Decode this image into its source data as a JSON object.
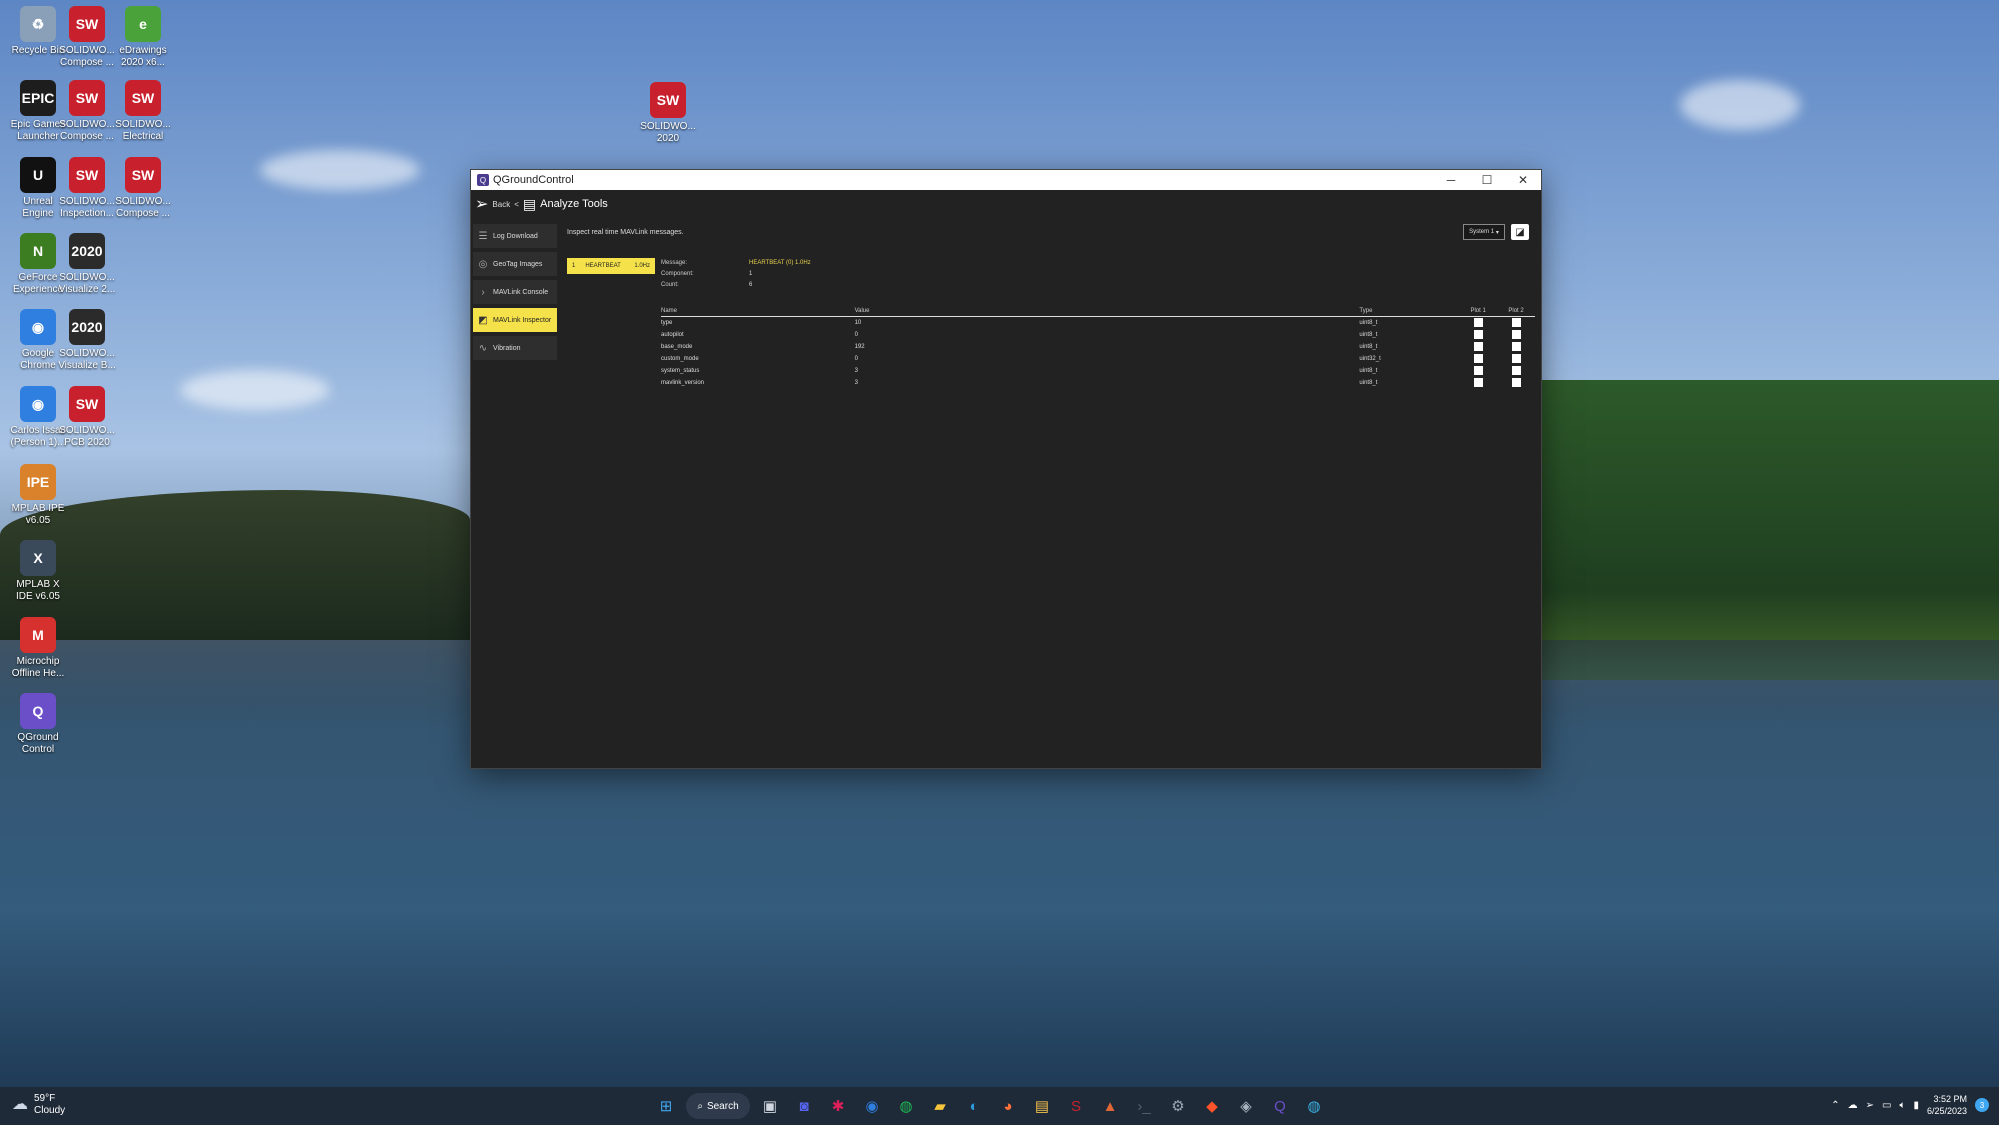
{
  "desktop": {
    "icons": [
      {
        "label": "Recycle Bin",
        "glyph": "♻",
        "color": "#8aa0b8"
      },
      {
        "label": "SOLIDWO... Compose ...",
        "glyph": "SW",
        "color": "#c8202d"
      },
      {
        "label": "eDrawings 2020 x6...",
        "glyph": "e",
        "color": "#4aa23a"
      },
      {
        "label": "Epic Games Launcher",
        "glyph": "EPIC",
        "color": "#1d1d1d"
      },
      {
        "label": "SOLIDWO... Compose ...",
        "glyph": "SW",
        "color": "#c8202d"
      },
      {
        "label": "SOLIDWO... Electrical",
        "glyph": "SW",
        "color": "#c8202d"
      },
      {
        "label": "Unreal Engine",
        "glyph": "U",
        "color": "#111111"
      },
      {
        "label": "SOLIDWO... Inspection...",
        "glyph": "SW",
        "color": "#c8202d"
      },
      {
        "label": "SOLIDWO... Compose ...",
        "glyph": "SW",
        "color": "#c8202d"
      },
      {
        "label": "GeForce Experience",
        "glyph": "N",
        "color": "#3d7d22"
      },
      {
        "label": "SOLIDWO... Visualize 2...",
        "glyph": "2020",
        "color": "#2b2b2b"
      },
      {
        "label": "Google Chrome",
        "glyph": "◉",
        "color": "#2f7fe0"
      },
      {
        "label": "SOLIDWO... Visualize B...",
        "glyph": "2020",
        "color": "#2b2b2b"
      },
      {
        "label": "Carlos Issac (Person 1)...",
        "glyph": "◉",
        "color": "#2f7fe0"
      },
      {
        "label": "SOLIDWO... PCB 2020",
        "glyph": "SW",
        "color": "#c8202d"
      },
      {
        "label": "MPLAB IPE v6.05",
        "glyph": "IPE",
        "color": "#d9822b"
      },
      {
        "label": "MPLAB X IDE v6.05",
        "glyph": "X",
        "color": "#3a4a5a"
      },
      {
        "label": "Microchip Offline He...",
        "glyph": "M",
        "color": "#d6312f"
      },
      {
        "label": "QGround Control",
        "glyph": "Q",
        "color": "#6b4fc9"
      },
      {
        "label": "SOLIDWO... 2020",
        "glyph": "SW",
        "color": "#c8202d"
      }
    ]
  },
  "window": {
    "title": "QGroundControl",
    "minimize": "─",
    "maximize": "☐",
    "close": "✕",
    "back_label": "Back",
    "page_title": "Analyze Tools"
  },
  "sidebar": {
    "items": [
      {
        "label": "Log Download",
        "icon": "☰",
        "active": false
      },
      {
        "label": "GeoTag Images",
        "icon": "◎",
        "active": false
      },
      {
        "label": "MAVLink Console",
        "icon": "›",
        "active": false
      },
      {
        "label": "MAVLink Inspector",
        "icon": "◩",
        "active": true
      },
      {
        "label": "Vibration",
        "icon": "∿",
        "active": false
      }
    ]
  },
  "inspector": {
    "hint": "Inspect real time MAVLink messages.",
    "system_select": "System 1",
    "message_list": [
      {
        "id": "1",
        "name": "HEARTBEAT",
        "rate": "1.0Hz"
      }
    ],
    "info": [
      {
        "key": "Message:",
        "value": "HEARTBEAT (0) 1.0Hz",
        "highlight": true
      },
      {
        "key": "Component:",
        "value": "1",
        "highlight": false
      },
      {
        "key": "Count:",
        "value": "6",
        "highlight": false
      }
    ],
    "columns": {
      "name": "Name",
      "value": "Value",
      "type": "Type",
      "plot1": "Plot 1",
      "plot2": "Plot 2"
    },
    "fields": [
      {
        "name": "type",
        "value": "10",
        "type": "uint8_t"
      },
      {
        "name": "autopilot",
        "value": "0",
        "type": "uint8_t"
      },
      {
        "name": "base_mode",
        "value": "192",
        "type": "uint8_t"
      },
      {
        "name": "custom_mode",
        "value": "0",
        "type": "uint32_t"
      },
      {
        "name": "system_status",
        "value": "3",
        "type": "uint8_t"
      },
      {
        "name": "mavlink_version",
        "value": "3",
        "type": "uint8_t"
      }
    ]
  },
  "taskbar": {
    "weather_temp": "59°F",
    "weather_desc": "Cloudy",
    "search_label": "Search",
    "time": "3:52 PM",
    "date": "6/25/2023",
    "apps": [
      {
        "name": "windows-start",
        "glyph": "⊞",
        "color": "#3fa6f0"
      },
      {
        "name": "task-view",
        "glyph": "▣",
        "color": "#cfd6df"
      },
      {
        "name": "discord",
        "glyph": "◙",
        "color": "#5865f2"
      },
      {
        "name": "slack",
        "glyph": "✱",
        "color": "#e01e5a"
      },
      {
        "name": "chrome",
        "glyph": "◉",
        "color": "#2f7fe0"
      },
      {
        "name": "spotify",
        "glyph": "◍",
        "color": "#1db954"
      },
      {
        "name": "sticky-notes",
        "glyph": "▰",
        "color": "#f6c53c"
      },
      {
        "name": "edge",
        "glyph": "◐",
        "color": "#2b9ad8"
      },
      {
        "name": "firefox",
        "glyph": "◕",
        "color": "#ff7139"
      },
      {
        "name": "file-explorer",
        "glyph": "▤",
        "color": "#f3c14b"
      },
      {
        "name": "solidworks",
        "glyph": "S",
        "color": "#c8202d"
      },
      {
        "name": "matlab",
        "glyph": "▲",
        "color": "#e16737"
      },
      {
        "name": "terminal",
        "glyph": "›_",
        "color": "#555f6d"
      },
      {
        "name": "steam",
        "glyph": "⚙",
        "color": "#9aa6b4"
      },
      {
        "name": "brave",
        "glyph": "◆",
        "color": "#fb542b"
      },
      {
        "name": "app-generic",
        "glyph": "◈",
        "color": "#aab4c0"
      },
      {
        "name": "qgroundcontrol",
        "glyph": "Q",
        "color": "#6b4fc9"
      },
      {
        "name": "globe",
        "glyph": "◍",
        "color": "#3ab0e2"
      }
    ]
  }
}
